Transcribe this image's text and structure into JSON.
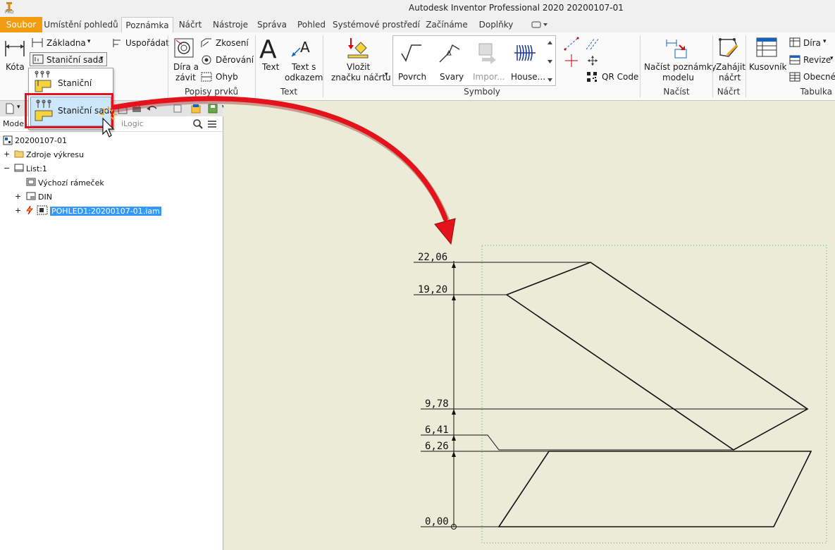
{
  "window": {
    "title": "Autodesk Inventor Professional 2020   20200107-01",
    "logo_text": "PRO"
  },
  "tabs": [
    "Soubor",
    "Umístění pohledů",
    "Poznámka",
    "Náčrt",
    "Nástroje",
    "Správa",
    "Pohled",
    "Systémové prostředí",
    "Začínáme",
    "Doplňky"
  ],
  "ribbon": {
    "kota": "Kóta",
    "zakladna": "Základna",
    "stanicni_sada": "Staniční sada",
    "usporadat": "Uspořádat",
    "dira_a_zavit_1": "Díra a",
    "dira_a_zavit_2": "závit",
    "zkoseni": "Zkosení",
    "derovani": "Děrování",
    "ohyb": "Ohyb",
    "panel_popisy": "Popisy prvků",
    "text": "Text",
    "text_s_odkazem_1": "Text s",
    "text_s_odkazem_2": "odkazem",
    "panel_text": "Text",
    "vlozit_1": "Vložit",
    "vlozit_2": "značku náčrtu",
    "povrch": "Povrch",
    "svary": "Svary",
    "impor": "Impor...",
    "house": "House...",
    "qr_code": "QR Code",
    "panel_symboly": "Symboly",
    "nacist_1": "Načíst poznámky",
    "nacist_2": "modelu",
    "panel_nacist": "Načíst",
    "zahajit_1": "Zahájit",
    "zahajit_2": "náčrt",
    "panel_nacrt": "Náčrt",
    "kusovnik": "Kusovník",
    "dira": "Díra",
    "revize": "Revize",
    "obecne": "Obecné",
    "panel_tabulka": "Tabulka"
  },
  "dropdown": {
    "item1": "Staniční",
    "item2": "Staniční sada"
  },
  "browser": {
    "tab_model": "Model",
    "tab_ilogic": "iLogic",
    "items": [
      "20200107-01",
      "Zdroje výkresu",
      "List:1",
      "Výchozí rámeček",
      "DIN",
      "POHLED1:20200107-01.iam"
    ]
  },
  "dimensions": [
    "22,06",
    "19,20",
    "9,78",
    "6,41",
    "6,26",
    "0,00"
  ],
  "colors": {
    "file_tab": "#f39c12",
    "canvas": "#ecebd8",
    "highlight_red": "#e3121b",
    "selection_blue": "#3399ff"
  }
}
